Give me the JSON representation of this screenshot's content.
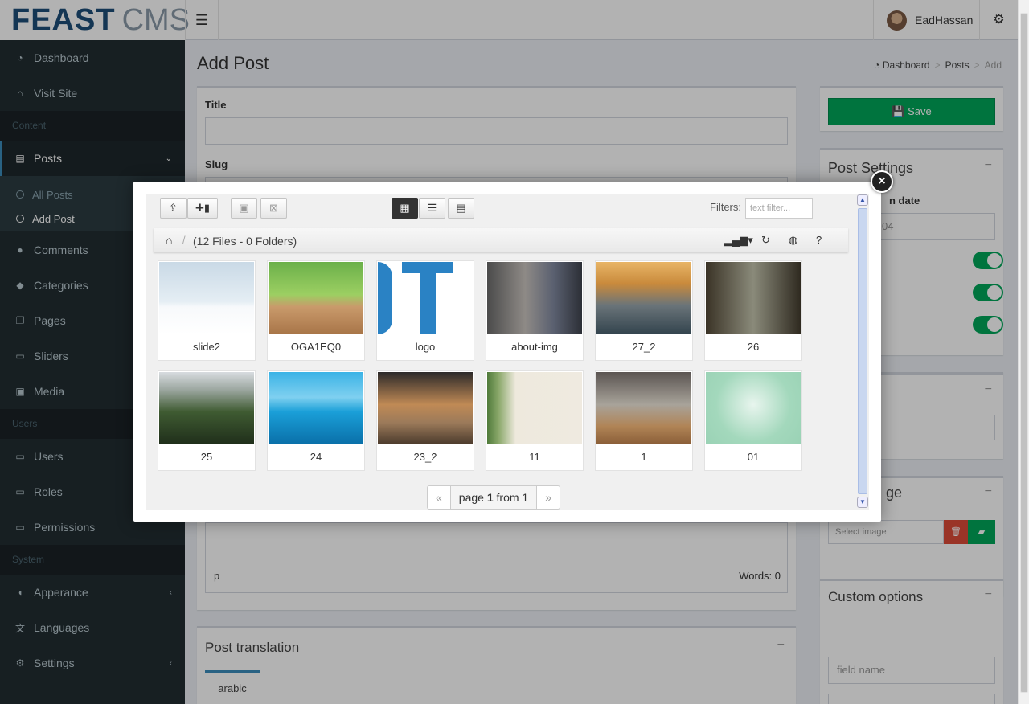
{
  "app": {
    "logo_bold": "FEAST",
    "logo_light": "CMS",
    "user_name": "EadHassan"
  },
  "sidebar": {
    "top": [
      {
        "label": "Dashboard",
        "icon": "dashboard-icon"
      },
      {
        "label": "Visit Site",
        "icon": "home-icon"
      }
    ],
    "content_header": "Content",
    "posts": {
      "label": "Posts",
      "sub": [
        "All Posts",
        "Add Post"
      ]
    },
    "content_items": [
      {
        "label": "Comments",
        "icon": "comment-icon"
      },
      {
        "label": "Categories",
        "icon": "tags-icon"
      },
      {
        "label": "Pages",
        "icon": "pages-icon"
      },
      {
        "label": "Sliders",
        "icon": "monitor-icon"
      },
      {
        "label": "Media",
        "icon": "image-icon"
      }
    ],
    "users_header": "Users",
    "users_items": [
      {
        "label": "Users"
      },
      {
        "label": "Roles"
      },
      {
        "label": "Permissions"
      }
    ],
    "system_header": "System",
    "system_items": [
      {
        "label": "Apperance"
      },
      {
        "label": "Languages"
      },
      {
        "label": "Settings"
      }
    ]
  },
  "page": {
    "title": "Add Post",
    "breadcrumb": [
      "Dashboard",
      "Posts",
      "Add"
    ],
    "fields": {
      "title_label": "Title",
      "slug_label": "Slug"
    },
    "editor_status": "p",
    "word_count": "Words: 0",
    "translation_title": "Post translation",
    "translation_tab": "arabic"
  },
  "right": {
    "save_label": "Save",
    "settings_title": "Post Settings",
    "publish_label_partial": "n date",
    "date_partial": "04",
    "image_title_partial": "ge",
    "image_placeholder": "Select image",
    "custom_title": "Custom options",
    "field_name_placeholder": "field name"
  },
  "file_manager": {
    "filters_label": "Filters:",
    "filter_placeholder": "text filter...",
    "path_info": "(12 Files - 0 Folders)",
    "files": [
      {
        "name": "slide2"
      },
      {
        "name": "OGA1EQ0"
      },
      {
        "name": "logo"
      },
      {
        "name": "about-img"
      },
      {
        "name": "27_2"
      },
      {
        "name": "26"
      },
      {
        "name": "25"
      },
      {
        "name": "24"
      },
      {
        "name": "23_2"
      },
      {
        "name": "11"
      },
      {
        "name": "1"
      },
      {
        "name": "01"
      }
    ],
    "pager": {
      "prev": "«",
      "page_word": "page",
      "page": "1",
      "from_word": "from",
      "total": "1",
      "next": "»"
    }
  }
}
